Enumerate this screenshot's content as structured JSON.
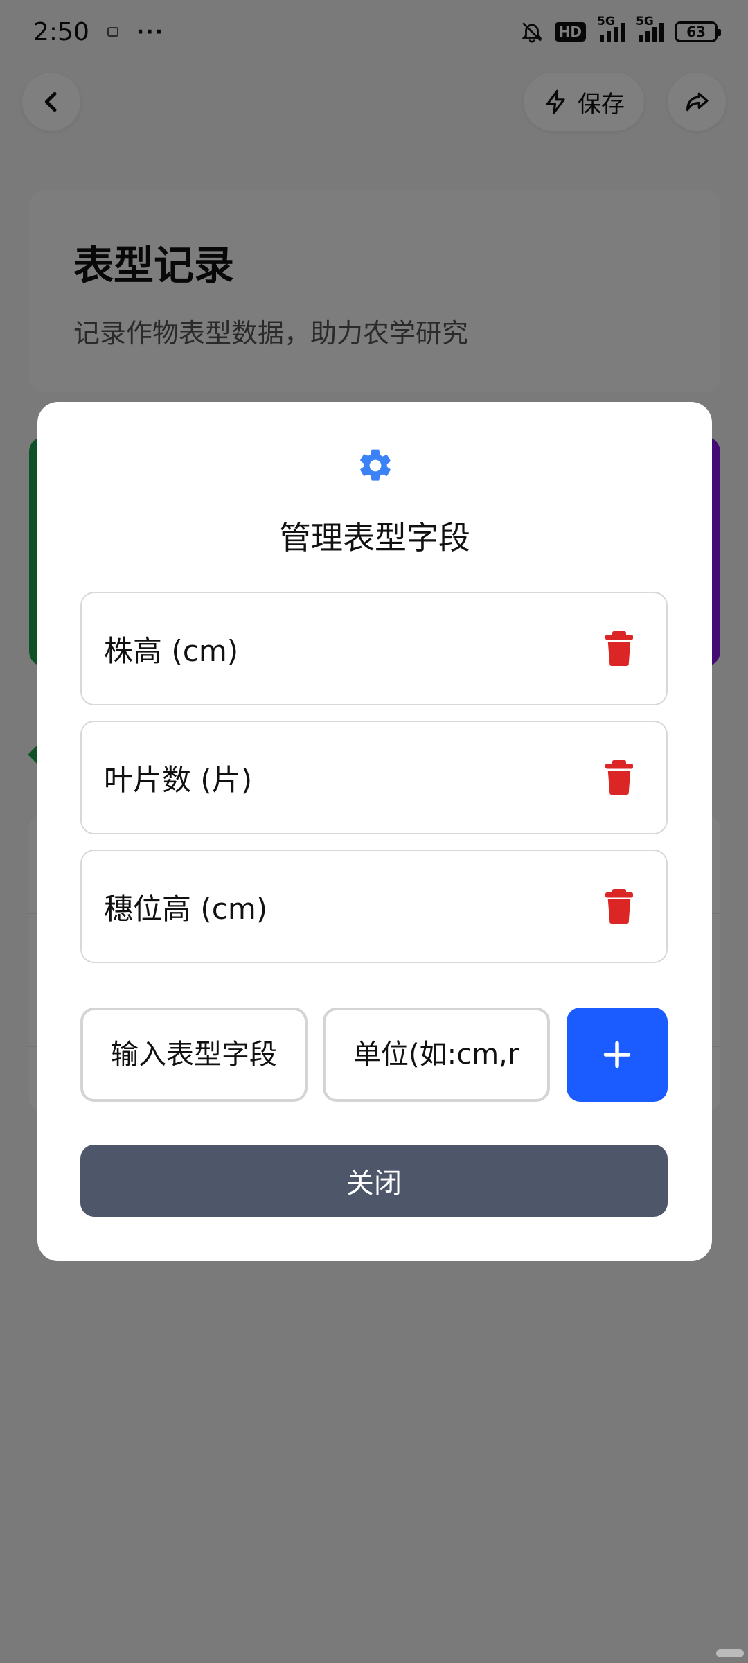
{
  "status_bar": {
    "time": "2:50",
    "dots": "···",
    "hd_label": "HD",
    "network_1": "5G",
    "network_2": "5G",
    "battery": "63"
  },
  "header": {
    "save_label": "保存"
  },
  "hero": {
    "title": "表型记录",
    "subtitle": "记录作物表型数据，助力农学研究"
  },
  "modal": {
    "title": "管理表型字段",
    "fields": [
      {
        "label": "株高 (cm)"
      },
      {
        "label": "叶片数 (片)"
      },
      {
        "label": "穗位高 (cm)"
      }
    ],
    "name_placeholder": "输入表型字段",
    "unit_placeholder": "单位(如:cm,mm)",
    "close_label": "关闭"
  },
  "colors": {
    "accent_blue": "#1a5cff",
    "gear_blue": "#3b82f6",
    "trash_red": "#dc2626",
    "close_gray": "#4d5769",
    "stat_green": "#1aa34a",
    "stat_purple": "#8a16e8"
  }
}
